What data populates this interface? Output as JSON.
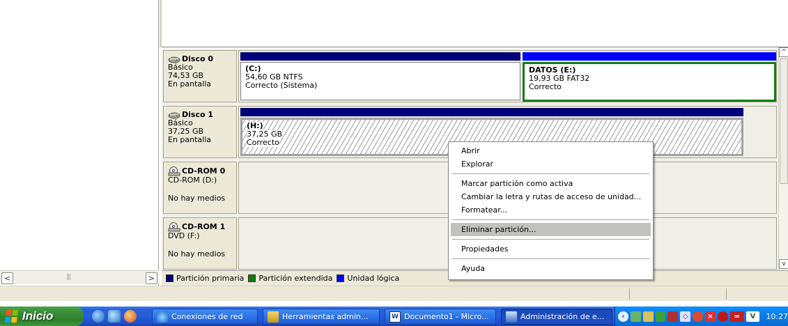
{
  "disks": [
    {
      "name": "Disco 0",
      "type": "Básico",
      "size": "74,53 GB",
      "status": "En pantalla",
      "partitions": [
        {
          "label": "(C:)",
          "detail": "54,60 GB NTFS",
          "status": "Correcto (Sistema)"
        },
        {
          "label": "DATOS  (E:)",
          "detail": "19,93 GB FAT32",
          "status": "Correcto"
        }
      ]
    },
    {
      "name": "Disco 1",
      "type": "Básico",
      "size": "37,25 GB",
      "status": "En pantalla",
      "partitions": [
        {
          "label": "(H:)",
          "detail": "37,25 GB",
          "status": "Correcto"
        }
      ]
    }
  ],
  "cdroms": [
    {
      "name": "CD-ROM 0",
      "drive": "CD-ROM (D:)",
      "status": "No hay medios"
    },
    {
      "name": "CD-ROM 1",
      "drive": "DVD (F:)",
      "status": "No hay medios"
    }
  ],
  "legend": [
    {
      "label": "Partición primaria",
      "color": "#00007f"
    },
    {
      "label": "Partición extendida",
      "color": "#117e11"
    },
    {
      "label": "Unidad lógica",
      "color": "#0000ff"
    }
  ],
  "context_menu": {
    "items": [
      "Abrir",
      "Explorar",
      "Marcar partición como activa",
      "Cambiar la letra y rutas de acceso de unidad...",
      "Formatear...",
      "Eliminar partición...",
      "Propiedades",
      "Ayuda"
    ],
    "highlighted": "Eliminar partición..."
  },
  "scrollbar": {
    "left_arrow": "<",
    "right_arrow": ">",
    "up_arrow": "^",
    "down_arrow": "v"
  },
  "taskbar": {
    "start_label": "Inicio",
    "tasks": [
      "Conexiones de red",
      "Herramientas admin...",
      "Documento1 - Micro...",
      "Administración de e..."
    ],
    "active_task": "Administración de e...",
    "clock": "10:27"
  },
  "colors": {
    "primary_partition": "#00007f",
    "extended_partition": "#117e11",
    "logical_drive": "#0000ff",
    "taskbar_blue": "#245edb",
    "start_green": "#3c8e3a"
  },
  "icons": [
    "disk-icon",
    "cdrom-icon",
    "ie-icon",
    "desktop-icon",
    "media-icon",
    "network-icon",
    "tools-icon",
    "word-icon",
    "computer-management-icon"
  ]
}
